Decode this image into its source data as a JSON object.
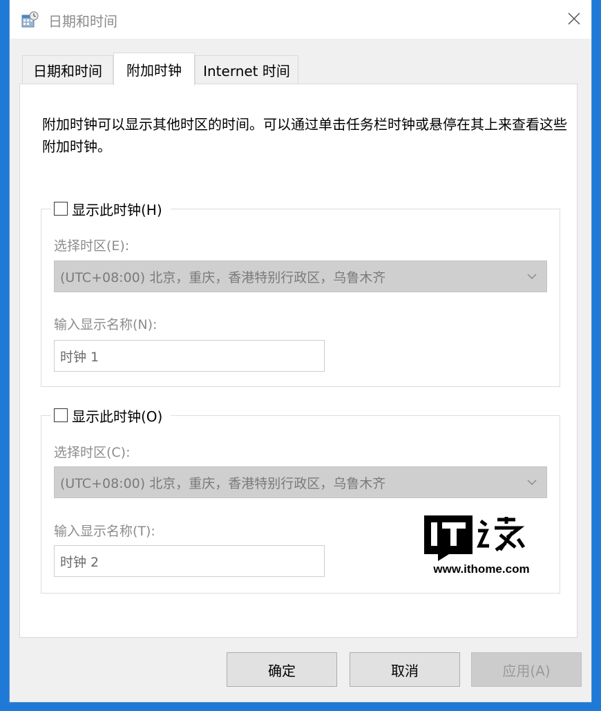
{
  "window": {
    "title": "日期和时间"
  },
  "tabs": [
    {
      "label": "日期和时间",
      "active": false
    },
    {
      "label": "附加时钟",
      "active": true
    },
    {
      "label": "Internet 时间",
      "active": false
    }
  ],
  "description": "附加时钟可以显示其他时区的时间。可以通过单击任务栏时钟或悬停在其上来查看这些附加时钟。",
  "clock1": {
    "checkbox_label": "显示此时钟(H)",
    "checked": false,
    "timezone_label": "选择时区(E):",
    "timezone_value": "(UTC+08:00) 北京，重庆，香港特别行政区，乌鲁木齐",
    "name_label": "输入显示名称(N):",
    "name_value": "时钟 1"
  },
  "clock2": {
    "checkbox_label": "显示此时钟(O)",
    "checked": false,
    "timezone_label": "选择时区(C):",
    "timezone_value": "(UTC+08:00) 北京，重庆，香港特别行政区，乌鲁木齐",
    "name_label": "输入显示名称(T):",
    "name_value": "时钟 2"
  },
  "watermark": {
    "brand": "IT之家",
    "url": "www.ithome.com"
  },
  "buttons": {
    "ok": "确定",
    "cancel": "取消",
    "apply": "应用(A)"
  },
  "colors": {
    "desktop": "#1e7ad6",
    "disabled_select": "#cfcfcf"
  }
}
